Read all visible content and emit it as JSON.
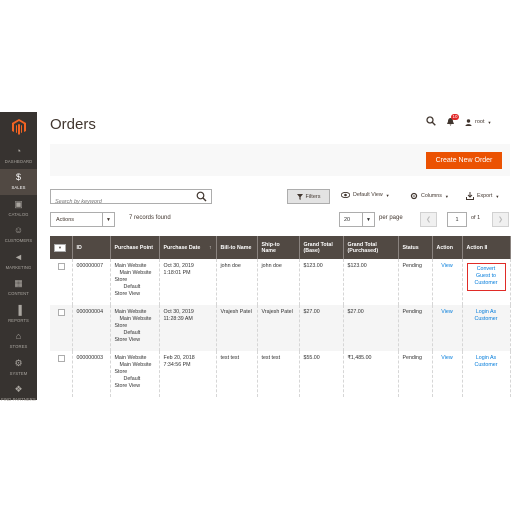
{
  "sidebar": {
    "items": [
      {
        "label": "Dashboard",
        "icon": "dashboard-icon",
        "glyph": "◔"
      },
      {
        "label": "Sales",
        "icon": "dollar-icon",
        "glyph": "$"
      },
      {
        "label": "Catalog",
        "icon": "cube-icon",
        "glyph": "▣"
      },
      {
        "label": "Customers",
        "icon": "person-icon",
        "glyph": "☺"
      },
      {
        "label": "Marketing",
        "icon": "megaphone-icon",
        "glyph": "◄"
      },
      {
        "label": "Content",
        "icon": "layout-icon",
        "glyph": "▦"
      },
      {
        "label": "Reports",
        "icon": "bar-chart-icon",
        "glyph": "▐"
      },
      {
        "label": "Stores",
        "icon": "store-icon",
        "glyph": "⌂"
      },
      {
        "label": "System",
        "icon": "gear-icon",
        "glyph": "⚙"
      },
      {
        "label": "Find Partners",
        "icon": "puzzle-icon",
        "glyph": "❖"
      }
    ]
  },
  "header": {
    "title": "Orders",
    "notification_count": "10",
    "user": "root"
  },
  "actionbar": {
    "create_label": "Create New Order"
  },
  "toolbar": {
    "search_placeholder": "Search by keyword",
    "filters_label": "Filters",
    "view_label": "Default View",
    "columns_label": "Columns",
    "export_label": "Export",
    "actions_label": "Actions",
    "records": "7 records found",
    "per_page_value": "20",
    "per_page_label": "per page",
    "page_value": "1",
    "page_of": "of 1"
  },
  "table": {
    "columns": [
      "ID",
      "Purchase Point",
      "Purchase Date",
      "Bill-to Name",
      "Ship-to Name",
      "Grand Total (Base)",
      "Grand Total (Purchased)",
      "Status",
      "Action",
      "Action II"
    ],
    "rows": [
      {
        "id": "000000007",
        "pp1": "Main Website",
        "pp2": "Main Website",
        "pp3": "Store",
        "pp4": "Default",
        "pp5": "Store View",
        "date": "Oct 30, 2019",
        "time": "1:18:01 PM",
        "bill": "john doe",
        "ship": "john doe",
        "base": "$123.00",
        "purchased": "$123.00",
        "status": "Pending",
        "action": "View",
        "action2": "Convert Guest to Customer"
      },
      {
        "id": "000000004",
        "pp1": "Main Website",
        "pp2": "Main Website",
        "pp3": "Store",
        "pp4": "Default",
        "pp5": "Store View",
        "date": "Oct 30, 2019",
        "time": "11:28:39 AM",
        "bill": "Vrajesh Patel",
        "ship": "Vrajesh Patel",
        "base": "$27.00",
        "purchased": "$27.00",
        "status": "Pending",
        "action": "View",
        "action2": "Login As Customer"
      },
      {
        "id": "000000003",
        "pp1": "Main Website",
        "pp2": "Main Website",
        "pp3": "Store",
        "pp4": "Default",
        "pp5": "Store View",
        "date": "Feb 20, 2018",
        "time": "7:34:56 PM",
        "bill": "test test",
        "ship": "test test",
        "base": "$55.00",
        "purchased": "₹1,485.00",
        "status": "Pending",
        "action": "View",
        "action2": "Login As Customer"
      }
    ]
  },
  "colors": {
    "sidebar_bg": "#373330",
    "sidebar_active": "#514943",
    "primary": "#eb5202",
    "table_header": "#514943",
    "link": "#007bdb",
    "highlight": "#e02b27"
  }
}
